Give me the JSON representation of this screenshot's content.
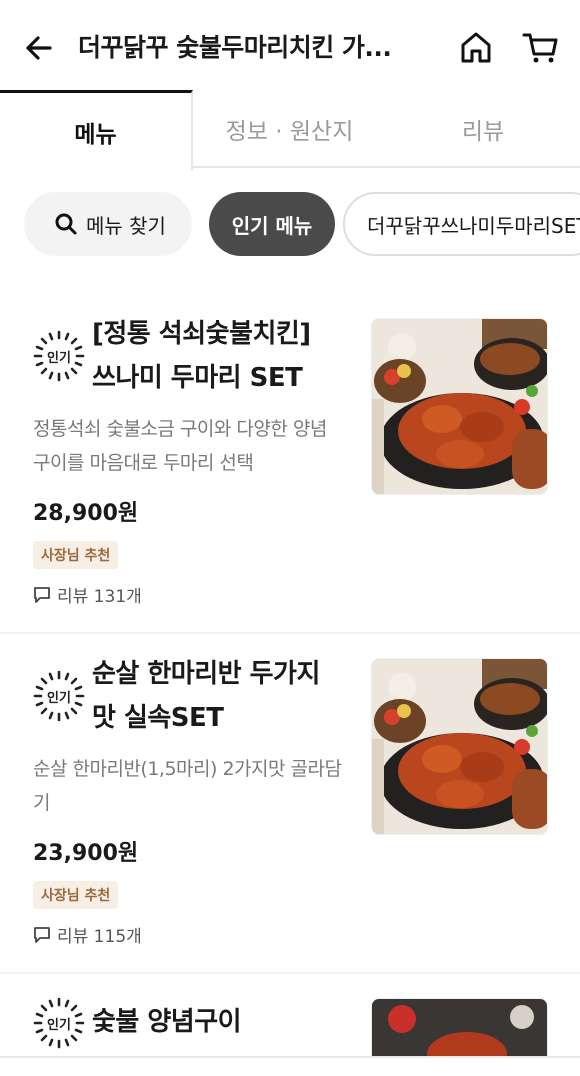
{
  "header": {
    "title": "더꾸닭꾸 숯불두마리치킨 가...",
    "back_icon": "arrow-left-icon",
    "home_icon": "home-icon",
    "cart_icon": "cart-icon"
  },
  "tabs": [
    {
      "label": "메뉴",
      "active": true
    },
    {
      "label": "정보 · 원산지",
      "active": false
    },
    {
      "label": "리뷰",
      "active": false
    }
  ],
  "chips": {
    "search": "메뉴 찾기",
    "popular": "인기 메뉴",
    "set": "더꾸닭꾸쓰나미두마리SET"
  },
  "popular_badge": "인기",
  "owner_pick": "사장님 추천",
  "items": [
    {
      "name": "[정통 석쇠숯불치킨] 쓰나미 두마리 SET",
      "description": "정통석쇠 숯불소금 구이와 다양한 양념구이를 마음대로 두마리 선택",
      "price": "28,900원",
      "reviews": "리뷰 131개"
    },
    {
      "name": "순살 한마리반 두가지맛 실속SET",
      "description": "순살 한마리반(1,5마리) 2가지맛 골라담기",
      "price": "23,900원",
      "reviews": "리뷰 115개"
    },
    {
      "name": "숯불 양념구이"
    }
  ],
  "colors": {
    "accent_dark": "#4a4a4a",
    "owner_badge_bg": "#f7efe6",
    "owner_badge_text": "#9a6a3a"
  }
}
